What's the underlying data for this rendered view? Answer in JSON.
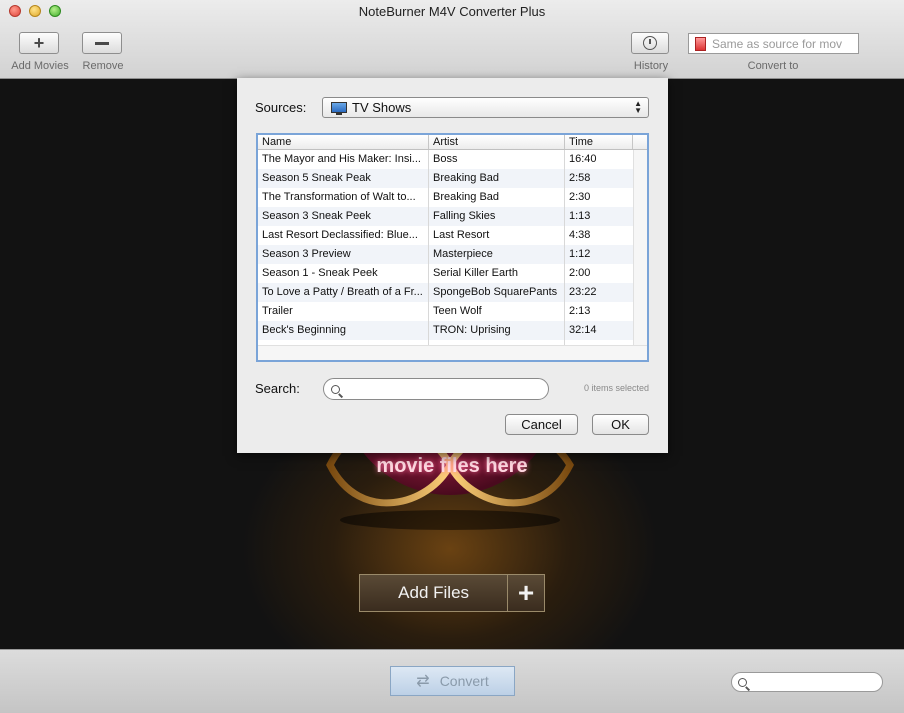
{
  "app": {
    "title": "NoteBurner M4V Converter Plus"
  },
  "toolbar": {
    "add_label": "Add Movies",
    "remove_label": "Remove",
    "history_label": "History",
    "convert_to_label": "Convert to",
    "convert_to_value": "Same as source for mov"
  },
  "stage": {
    "drop_hint": "movie files here",
    "add_files_label": "Add Files",
    "add_files_plus": "+"
  },
  "bottom": {
    "convert_label": "Convert",
    "convert_glyph": "⇄",
    "search_value": ""
  },
  "dialog": {
    "sources_label": "Sources:",
    "sources_value": "TV Shows",
    "columns": [
      "Name",
      "Artist",
      "Time"
    ],
    "rows": [
      {
        "name": "The Mayor and His Maker: Insi...",
        "artist": "Boss",
        "time": "16:40"
      },
      {
        "name": "Season 5 Sneak Peak",
        "artist": "Breaking Bad",
        "time": "2:58"
      },
      {
        "name": "The Transformation of Walt to...",
        "artist": "Breaking Bad",
        "time": "2:30"
      },
      {
        "name": "Season 3 Sneak Peek",
        "artist": "Falling Skies",
        "time": "1:13"
      },
      {
        "name": "Last Resort Declassified: Blue...",
        "artist": "Last Resort",
        "time": "4:38"
      },
      {
        "name": "Season 3 Preview",
        "artist": "Masterpiece",
        "time": "1:12"
      },
      {
        "name": "Season 1 - Sneak Peek",
        "artist": "Serial Killer Earth",
        "time": "2:00"
      },
      {
        "name": "To Love a Patty / Breath of a Fr...",
        "artist": "SpongeBob SquarePants",
        "time": "23:22"
      },
      {
        "name": "Trailer",
        "artist": "Teen Wolf",
        "time": "2:13"
      },
      {
        "name": "Beck's Beginning",
        "artist": "TRON: Uprising",
        "time": "32:14"
      }
    ],
    "search_label": "Search:",
    "search_value": "",
    "selection_count": "0 items selected",
    "cancel_label": "Cancel",
    "ok_label": "OK"
  }
}
